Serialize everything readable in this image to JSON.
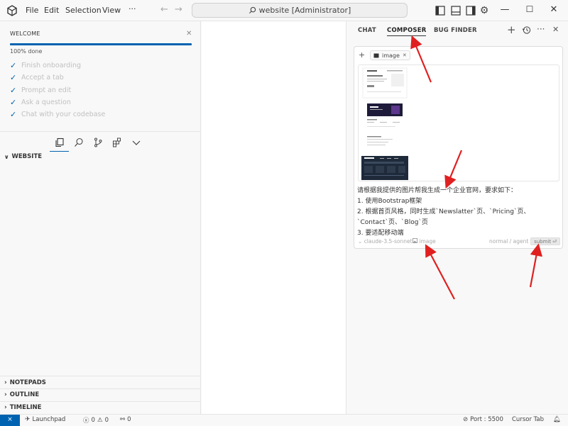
{
  "titlebar": {
    "menus": [
      {
        "label": "File"
      },
      {
        "label": "Edit"
      },
      {
        "label": "Selection"
      },
      {
        "label": "View"
      }
    ],
    "more": "···",
    "search_text": "website [Administrator]",
    "back_icon": "arrow-left-icon",
    "forward_icon": "arrow-right-icon"
  },
  "welcome": {
    "title": "WELCOME",
    "progress_label": "100% done",
    "progress": 1.0,
    "items": [
      {
        "label": "Finish onboarding"
      },
      {
        "label": "Accept a tab"
      },
      {
        "label": "Prompt an edit"
      },
      {
        "label": "Ask a question"
      },
      {
        "label": "Chat with your codebase"
      }
    ]
  },
  "explorer": {
    "section": "WEBSITE",
    "bottom_sections": [
      {
        "label": "NOTEPADS"
      },
      {
        "label": "OUTLINE"
      },
      {
        "label": "TIMELINE"
      }
    ]
  },
  "panel": {
    "tabs": [
      {
        "label": "CHAT"
      },
      {
        "label": "COMPOSER"
      },
      {
        "label": "BUG FINDER"
      }
    ],
    "active_tab": "COMPOSER",
    "pill_label": "image",
    "prompt_lines": [
      "请根据我提供的图片帮我生成一个企业官网，要求如下：",
      "1. 使用Bootstrap框架",
      "2. 根据首页风格，同时生成`Newslatter`页、`Pricing`页、",
      "`Contact`页、`Blog`页",
      "3. 要适配移动端"
    ],
    "model": "claude-3.5-sonnet",
    "image_label": "image",
    "mode_normal": "normal",
    "mode_sep": "/",
    "mode_agent": "agent",
    "submit_label": "submit"
  },
  "statusbar": {
    "launchpad": "Launchpad",
    "errors": "0",
    "warnings": "0",
    "ports_count": "0",
    "port": "Port : 5500",
    "cursor_tab": "Cursor Tab"
  },
  "colors": {
    "accent": "#0063b1",
    "arrow": "#e02020"
  }
}
